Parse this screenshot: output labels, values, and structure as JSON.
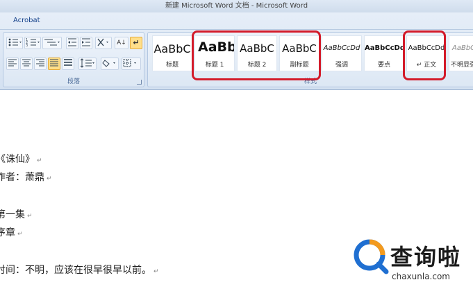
{
  "window": {
    "title": "新建 Microsoft Word 文档 - Microsoft Word"
  },
  "ribbon": {
    "tab_label": "Acrobat",
    "paragraph_group": {
      "label": "段落",
      "sort_glyph": "A↓",
      "show_marks_glyph": "↵"
    },
    "styles_group": {
      "label": "样式",
      "tiles": [
        {
          "sample": "AaBbC",
          "name": "标题"
        },
        {
          "sample": "AaBb",
          "name": "标题 1"
        },
        {
          "sample": "AaBbC",
          "name": "标题 2"
        },
        {
          "sample": "AaBbC",
          "name": "副标题"
        },
        {
          "sample": "AaBbCcDd",
          "name": "强调"
        },
        {
          "sample": "AaBbCcDd",
          "name": "要点"
        },
        {
          "sample": "AaBbCcDd",
          "name": "↵ 正文"
        },
        {
          "sample": "AaBbCc",
          "name": "不明显强调"
        }
      ]
    },
    "highlight_color": "#d31b2a"
  },
  "document": {
    "lines": [
      "《诛仙》",
      "作者：萧鼎",
      "第一集",
      "序章",
      "时间：不明，应该在很早很早以前。"
    ],
    "paragraph_mark": "↵"
  },
  "watermark": {
    "name": "查询啦",
    "url": "chaxunla.com"
  }
}
